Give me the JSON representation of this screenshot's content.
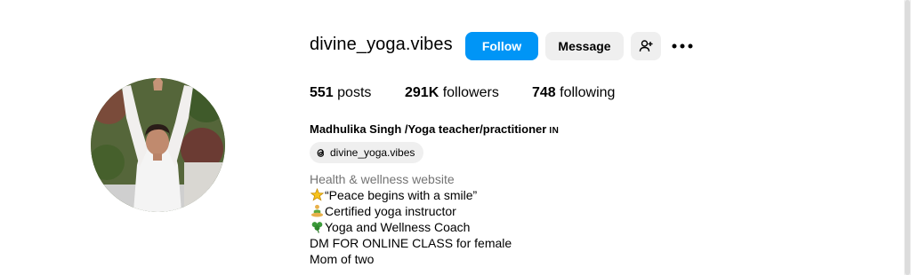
{
  "profile": {
    "username": "divine_yoga.vibes",
    "follow_label": "Follow",
    "message_label": "Message",
    "stats": {
      "posts_count": "551",
      "posts_label": "posts",
      "followers_count": "291K",
      "followers_label": "followers",
      "following_count": "748",
      "following_label": "following"
    },
    "full_name": "Madhulika Singh /Yoga teacher/practitioner",
    "pronoun": "IN",
    "threads_handle": "divine_yoga.vibes",
    "category": "Health & wellness website",
    "bio_lines": [
      {
        "icon": "star-emoji",
        "text": "“Peace begins with a smile”"
      },
      {
        "icon": "meditation-emoji",
        "text": "Certified yoga instructor"
      },
      {
        "icon": "shamrock-emoji",
        "text": "Yoga and Wellness Coach"
      },
      {
        "icon": "",
        "text": "DM FOR ONLINE CLASS for female"
      },
      {
        "icon": "",
        "text": "Mom of two"
      }
    ]
  },
  "colors": {
    "accent": "#0095f6",
    "secondary_button": "#efefef",
    "category_text": "#737373"
  },
  "icons": {
    "add_person": "add-person-icon",
    "more": "more-options-icon",
    "threads": "threads-icon"
  }
}
